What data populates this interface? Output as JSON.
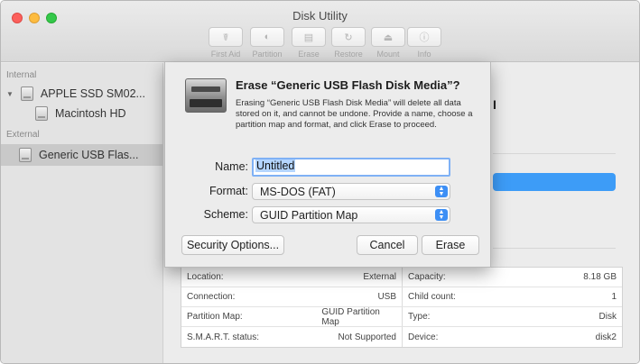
{
  "window": {
    "title": "Disk Utility"
  },
  "toolbar": {
    "items": [
      {
        "label": "First Aid",
        "icon": "stethoscope-icon"
      },
      {
        "label": "Partition",
        "icon": "partition-icon"
      },
      {
        "label": "Erase",
        "icon": "erase-icon"
      },
      {
        "label": "Restore",
        "icon": "restore-icon"
      },
      {
        "label": "Mount",
        "icon": "mount-icon"
      },
      {
        "label": "Info",
        "icon": "info-icon"
      }
    ]
  },
  "sidebar": {
    "internal_label": "Internal",
    "external_label": "External",
    "items": [
      {
        "label": "APPLE SSD SM02...",
        "icon": "internal-disk-icon"
      },
      {
        "label": "Macintosh HD",
        "icon": "volume-icon"
      },
      {
        "label": "Generic USB Flas...",
        "icon": "external-disk-icon"
      }
    ]
  },
  "dialog": {
    "title": "Erase “Generic USB Flash Disk Media”?",
    "body": "Erasing “Generic USB Flash Disk Media” will delete all data stored on it, and cannot be undone. Provide a name, choose a partition map and format, and click Erase to proceed.",
    "name_label": "Name:",
    "name_value": "Untitled",
    "format_label": "Format:",
    "format_value": "MS-DOS (FAT)",
    "scheme_label": "Scheme:",
    "scheme_value": "GUID Partition Map",
    "security_button": "Security Options...",
    "cancel_button": "Cancel",
    "erase_button": "Erase"
  },
  "info": {
    "rows": [
      {
        "k1": "Location:",
        "v1": "External",
        "k2": "Capacity:",
        "v2": "8.18 GB"
      },
      {
        "k1": "Connection:",
        "v1": "USB",
        "k2": "Child count:",
        "v2": "1"
      },
      {
        "k1": "Partition Map:",
        "v1": "GUID Partition Map",
        "k2": "Type:",
        "v2": "Disk"
      },
      {
        "k1": "S.M.A.R.T. status:",
        "v1": "Not Supported",
        "k2": "Device:",
        "v2": "disk2"
      }
    ]
  },
  "colors": {
    "accent": "#3d9cf7",
    "selection": "#b4d5fe"
  }
}
